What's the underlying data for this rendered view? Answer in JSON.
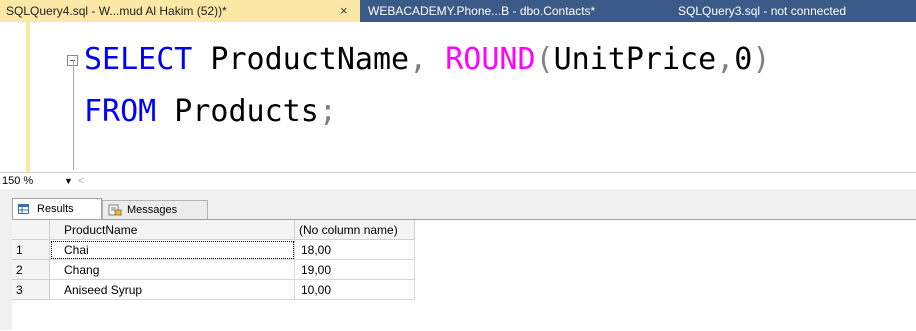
{
  "tabs": [
    {
      "label": "SQLQuery4.sql - W...mud Al Hakim (52))*",
      "close": "×"
    },
    {
      "label": "WEBACADEMY.Phone...B - dbo.Contacts*"
    },
    {
      "label": "SQLQuery3.sql - not connected"
    }
  ],
  "editor": {
    "line1": {
      "kw_select": "SELECT",
      "ident": " ProductName",
      "comma1": ",",
      "space": " ",
      "fn_round": "ROUND",
      "paren_open": "(",
      "arg": "UnitPrice",
      "comma2": ",",
      "num": "0",
      "paren_close": ")"
    },
    "line2": {
      "kw_from": "FROM",
      "ident": " Products",
      "semicolon": ";"
    }
  },
  "zoom": {
    "value": "150 %"
  },
  "result_tabs": {
    "results": "Results",
    "messages": "Messages"
  },
  "grid": {
    "columns": [
      "ProductName",
      "(No column name)"
    ],
    "rows": [
      {
        "num": "1",
        "product": "Chai",
        "price": "18,00"
      },
      {
        "num": "2",
        "product": "Chang",
        "price": "19,00"
      },
      {
        "num": "3",
        "product": "Aniseed Syrup",
        "price": "10,00"
      }
    ]
  },
  "colors": {
    "tab_active": "#fbe8a6",
    "tabstrip": "#3c5a88",
    "keyword": "#0000ff",
    "function": "#ff00ff"
  }
}
